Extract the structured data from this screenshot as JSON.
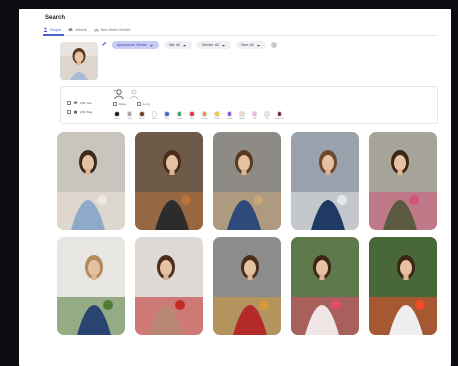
{
  "page": {
    "title": "Search"
  },
  "tabs": [
    {
      "label": "People",
      "icon": "person-icon",
      "active": true
    },
    {
      "label": "Vehicle",
      "icon": "car-icon",
      "active": false
    },
    {
      "label": "Non-Motor Vehicle",
      "icon": "bike-icon",
      "active": false
    }
  ],
  "filters": {
    "appearance": "Appearance Similar",
    "site": "Site: All",
    "gender": "Gender: All",
    "time": "Time: All"
  },
  "attributes": {
    "checkboxes": [
      {
        "label": "With Hat"
      },
      {
        "label": "With Bag"
      }
    ],
    "options": [
      {
        "label": "Move"
      },
      {
        "label": "Long"
      }
    ],
    "colors": [
      {
        "name": "Black",
        "hex": "#1b1b1b"
      },
      {
        "name": "Gray",
        "hex": "#a6a6a6"
      },
      {
        "name": "Brown",
        "hex": "#6b4226"
      },
      {
        "name": "White",
        "hex": "#ffffff"
      },
      {
        "name": "Blue",
        "hex": "#3c6fd4"
      },
      {
        "name": "Green",
        "hex": "#3aa64b"
      },
      {
        "name": "Red",
        "hex": "#e03a3a"
      },
      {
        "name": "Orange",
        "hex": "#f28b2c"
      },
      {
        "name": "Yellow",
        "hex": "#f2d12c"
      },
      {
        "name": "Purple",
        "hex": "#8d4fd1"
      },
      {
        "name": "Beige",
        "hex": "#e8dcc4"
      },
      {
        "name": "Pink",
        "hex": "#f4b6c8"
      },
      {
        "name": "Pale",
        "hex": "#f3e3dc"
      },
      {
        "name": "Burgundy",
        "hex": "#7a1f2b"
      }
    ]
  },
  "results": [
    {
      "icon": "woman-writing-photo",
      "bg": "#c9c4bd",
      "top": "#8fa9c9",
      "hair": "#3b2a1e",
      "accent": "#efe8dc"
    },
    {
      "icon": "woman-pottery-photo",
      "bg": "#6e5a48",
      "top": "#2c2c2c",
      "hair": "#4a2e1a",
      "accent": "#b8723c"
    },
    {
      "icon": "woman-warehouse-photo",
      "bg": "#8e8a86",
      "top": "#2e4a7a",
      "hair": "#5a3b22",
      "accent": "#c7a77a"
    },
    {
      "icon": "woman-hardhat-photo",
      "bg": "#9aa2ad",
      "top": "#203a66",
      "hair": "#6b4a2e",
      "accent": "#e8e8e8"
    },
    {
      "icon": "woman-flowershop-photo",
      "bg": "#a7a59a",
      "top": "#5d5a42",
      "hair": "#3b2514",
      "accent": "#d4557a"
    },
    {
      "icon": "woman-wreath-photo",
      "bg": "#e8e6e3",
      "top": "#2a4472",
      "hair": "#b58a5a",
      "accent": "#4f7a3a"
    },
    {
      "icon": "woman-cafe-photo",
      "bg": "#ded9d4",
      "top": "#b88874",
      "hair": "#4a2e1a",
      "accent": "#c22a2a"
    },
    {
      "icon": "woman-red-shirt-photo",
      "bg": "#8c8c8c",
      "top": "#b42a2a",
      "hair": "#4a2e1a",
      "accent": "#d49a3a"
    },
    {
      "icon": "woman-greenhouse-photo",
      "bg": "#5f7a4a",
      "top": "#f0e6e6",
      "hair": "#3b2514",
      "accent": "#e24a6a"
    },
    {
      "icon": "woman-garden-photo",
      "bg": "#49683a",
      "top": "#eeeeee",
      "hair": "#3b2514",
      "accent": "#f04a2a"
    }
  ]
}
